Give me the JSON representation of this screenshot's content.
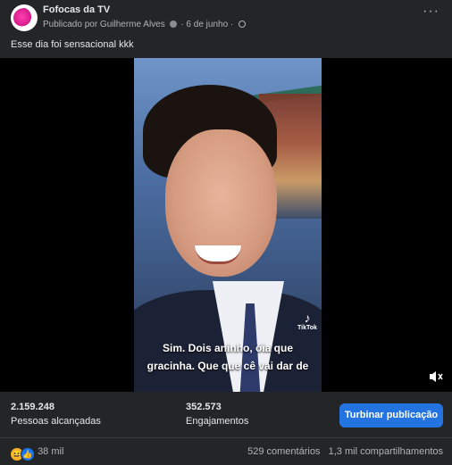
{
  "post": {
    "page_name": "Fofocas da TV",
    "published_by": "Publicado por Guilherme Alves",
    "date": "· 6 de junho ·",
    "caption": "Esse dia foi sensacional kkk",
    "more_icon": "more-horizontal-icon"
  },
  "video": {
    "subtitle_line1": "Sim. Dois aninho, óia que",
    "subtitle_line2": "gracinha. Que que cê vai dar de",
    "watermark": "TikTok",
    "volume_icon": "muted-speaker-icon"
  },
  "insights": {
    "reach_value": "2.159.248",
    "reach_label": "Pessoas alcançadas",
    "engagement_value": "352.573",
    "engagement_label": "Engajamentos",
    "boost_button": "Turbinar publicação"
  },
  "footer": {
    "reaction_count": "38 mil",
    "comments": "529 comentários",
    "shares": "1,3 mil compartilhamentos"
  },
  "colors": {
    "background": "#242526",
    "accent": "#2374e1"
  }
}
